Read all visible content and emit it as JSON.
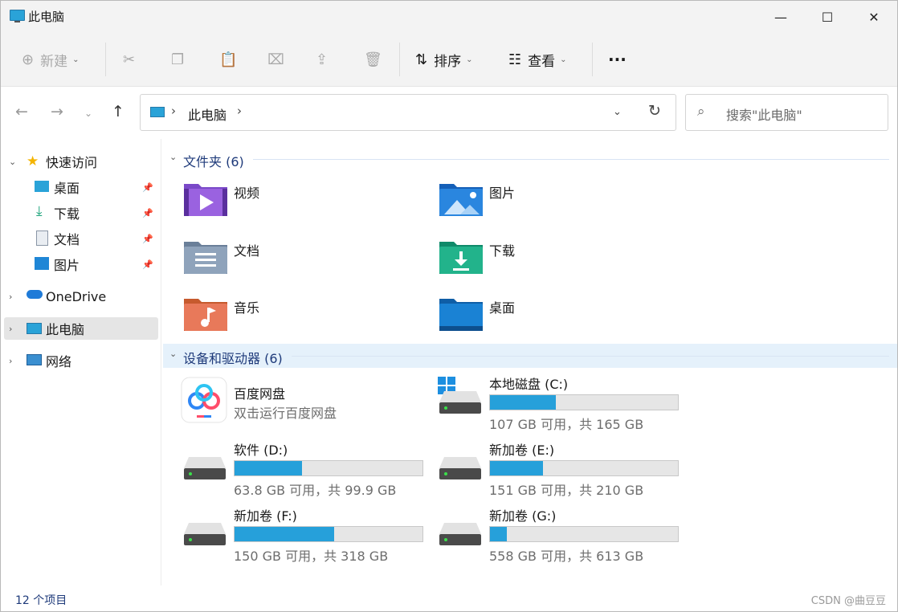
{
  "window": {
    "title": "此电脑",
    "controls": {
      "minimize": "—",
      "maximize": "☐",
      "close": "✕"
    }
  },
  "toolbar": {
    "new_label": "新建",
    "sort_label": "排序",
    "view_label": "查看",
    "more_label": "···"
  },
  "address": {
    "path_label": "此电脑",
    "search_placeholder": "搜索\"此电脑\""
  },
  "sidebar": {
    "quick_access": "快速访问",
    "pinned": [
      "桌面",
      "下载",
      "文档",
      "图片"
    ],
    "onedrive": "OneDrive",
    "this_pc": "此电脑",
    "network": "网络"
  },
  "folders_section": {
    "title": "文件夹 (6)",
    "items": [
      "视频",
      "图片",
      "文档",
      "下载",
      "音乐",
      "桌面"
    ]
  },
  "devices_section": {
    "title": "设备和驱动器 (6)",
    "baidu": {
      "name": "百度网盘",
      "subtitle": "双击运行百度网盘"
    },
    "drives": [
      {
        "name": "本地磁盘 (C:)",
        "free_text": "107 GB 可用，共 165 GB",
        "used_fraction": 0.35
      },
      {
        "name": "软件 (D:)",
        "free_text": "63.8 GB 可用，共 99.9 GB",
        "used_fraction": 0.36
      },
      {
        "name": "新加卷 (E:)",
        "free_text": "151 GB 可用，共 210 GB",
        "used_fraction": 0.28
      },
      {
        "name": "新加卷 (F:)",
        "free_text": "150 GB 可用，共 318 GB",
        "used_fraction": 0.53
      },
      {
        "name": "新加卷 (G:)",
        "free_text": "558 GB 可用，共 613 GB",
        "used_fraction": 0.09
      }
    ]
  },
  "status": {
    "item_count": "12 个项目",
    "watermark": "CSDN @曲豆豆"
  },
  "colors": {
    "accent": "#26a0da",
    "selection": "#e5e5e5",
    "section_text": "#1e3a7a"
  }
}
